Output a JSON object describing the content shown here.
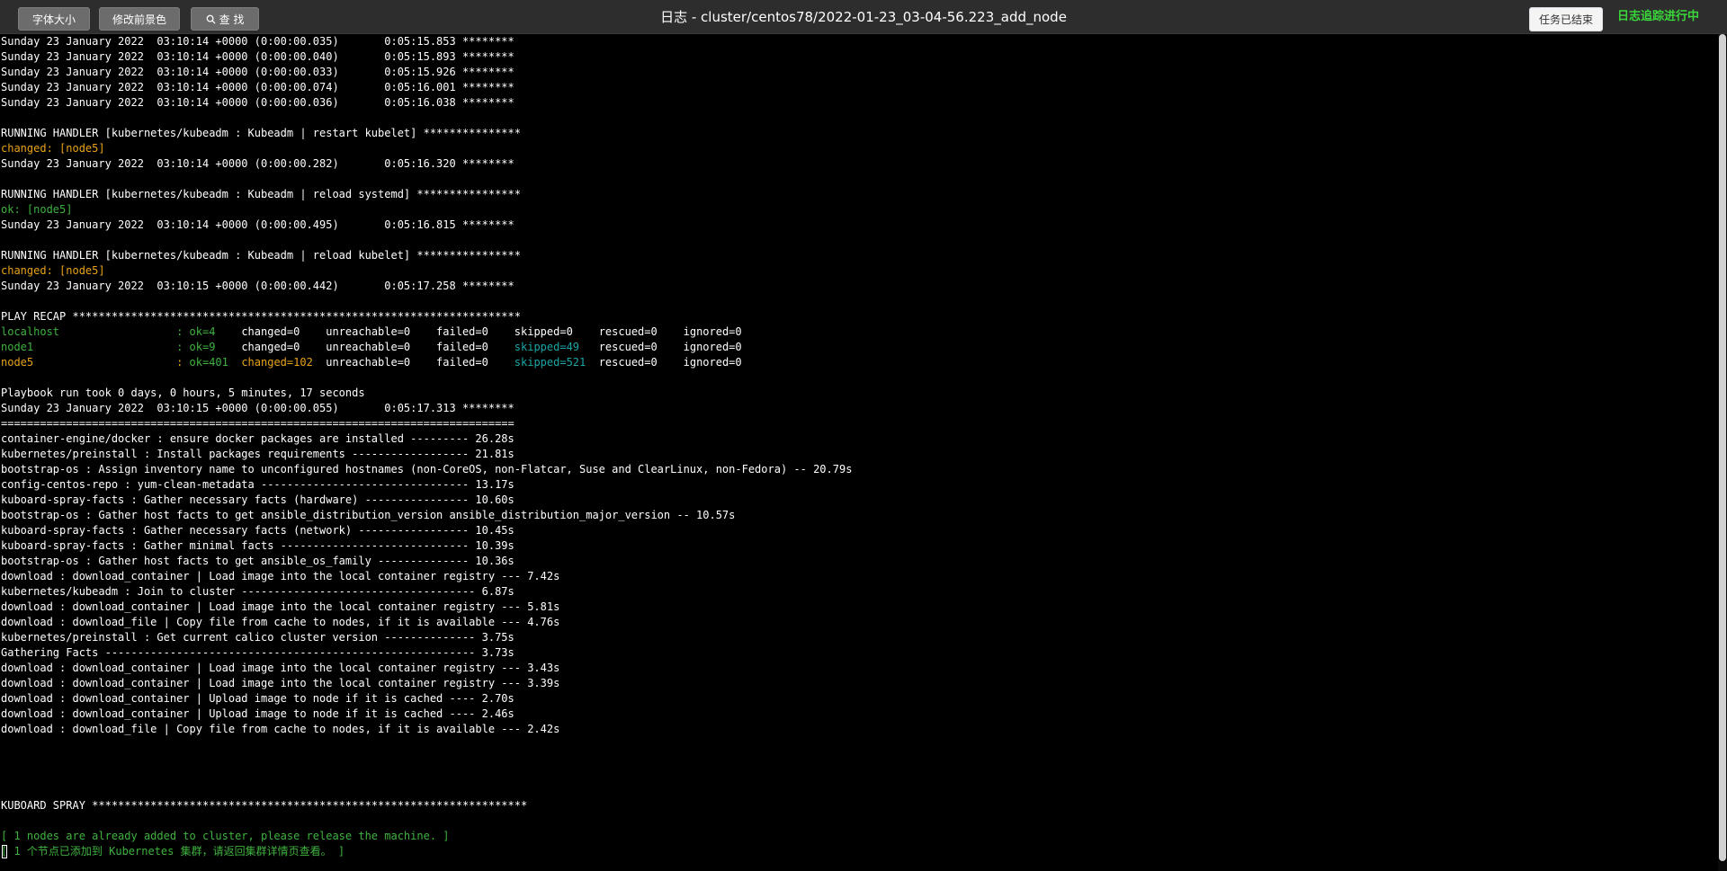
{
  "toolbar": {
    "font_size_label": "字体大小",
    "change_color_label": "修改前景色",
    "search_label": "查 找",
    "search_icon": "search-icon"
  },
  "title": "日志 - cluster/centos78/2022-01-23_03-04-56.223_add_node",
  "task_status_button": "任务已结束",
  "tracking_status": "日志追踪进行中",
  "colors": {
    "background": "#000000",
    "text": "#ffffff",
    "ok_green": "#3fb23f",
    "changed_orange": "#e8a317",
    "skipped_cyan": "#1aa5a5",
    "tracking_green": "#39d739"
  },
  "log": {
    "l0": "Sunday 23 January 2022  03:10:14 +0000 (0:00:00.035)       0:05:15.853 ********",
    "l1": "Sunday 23 January 2022  03:10:14 +0000 (0:00:00.040)       0:05:15.893 ********",
    "l2": "Sunday 23 January 2022  03:10:14 +0000 (0:00:00.033)       0:05:15.926 ********",
    "l3": "Sunday 23 January 2022  03:10:14 +0000 (0:00:00.074)       0:05:16.001 ********",
    "l4": "Sunday 23 January 2022  03:10:14 +0000 (0:00:00.036)       0:05:16.038 ********",
    "l5": "",
    "l6": "RUNNING HANDLER [kubernetes/kubeadm : Kubeadm | restart kubelet] ***************",
    "l7": "changed: [node5]",
    "l8": "Sunday 23 January 2022  03:10:14 +0000 (0:00:00.282)       0:05:16.320 ********",
    "l9": "",
    "l10": "RUNNING HANDLER [kubernetes/kubeadm : Kubeadm | reload systemd] ****************",
    "l11": "ok: [node5]",
    "l12": "Sunday 23 January 2022  03:10:14 +0000 (0:00:00.495)       0:05:16.815 ********",
    "l13": "",
    "l14": "RUNNING HANDLER [kubernetes/kubeadm : Kubeadm | reload kubelet] ****************",
    "l15": "changed: [node5]",
    "l16": "Sunday 23 January 2022  03:10:15 +0000 (0:00:00.442)       0:05:17.258 ********",
    "l17": "",
    "l18": "PLAY RECAP *********************************************************************",
    "r1_host": "localhost                  : ",
    "r1_ok": "ok=4   ",
    "r1_changed": " changed=0   ",
    "r1_mid": " unreachable=0    failed=0    ",
    "r1_skipped": "skipped=0   ",
    "r1_end": " rescued=0    ignored=0",
    "r2_host": "node1                      : ",
    "r2_ok": "ok=9   ",
    "r2_changed": " changed=0   ",
    "r2_mid": " unreachable=0    failed=0    ",
    "r2_skipped": "skipped=49  ",
    "r2_end": " rescued=0    ignored=0",
    "r3_host": "node5                      : ",
    "r3_ok": "ok=401 ",
    "r3_changed": " changed=102 ",
    "r3_mid": " unreachable=0    failed=0    ",
    "r3_skipped": "skipped=521 ",
    "r3_end": " rescued=0    ignored=0",
    "l22": "",
    "l23": "Playbook run took 0 days, 0 hours, 5 minutes, 17 seconds",
    "l24": "Sunday 23 January 2022  03:10:15 +0000 (0:00:00.055)       0:05:17.313 ********",
    "l25": "===============================================================================",
    "l26": "container-engine/docker : ensure docker packages are installed --------- 26.28s",
    "l27": "kubernetes/preinstall : Install packages requirements ------------------ 21.81s",
    "l28": "bootstrap-os : Assign inventory name to unconfigured hostnames (non-CoreOS, non-Flatcar, Suse and ClearLinux, non-Fedora) -- 20.79s",
    "l29": "config-centos-repo : yum-clean-metadata -------------------------------- 13.17s",
    "l30": "kuboard-spray-facts : Gather necessary facts (hardware) ---------------- 10.60s",
    "l31": "bootstrap-os : Gather host facts to get ansible_distribution_version ansible_distribution_major_version -- 10.57s",
    "l32": "kuboard-spray-facts : Gather necessary facts (network) ----------------- 10.45s",
    "l33": "kuboard-spray-facts : Gather minimal facts ----------------------------- 10.39s",
    "l34": "bootstrap-os : Gather host facts to get ansible_os_family -------------- 10.36s",
    "l35": "download : download_container | Load image into the local container registry --- 7.42s",
    "l36": "kubernetes/kubeadm : Join to cluster ------------------------------------ 6.87s",
    "l37": "download : download_container | Load image into the local container registry --- 5.81s",
    "l38": "download : download_file | Copy file from cache to nodes, if it is available --- 4.76s",
    "l39": "kubernetes/preinstall : Get current calico cluster version -------------- 3.75s",
    "l40": "Gathering Facts --------------------------------------------------------- 3.73s",
    "l41": "download : download_container | Load image into the local container registry --- 3.43s",
    "l42": "download : download_container | Load image into the local container registry --- 3.39s",
    "l43": "download : download_container | Upload image to node if it is cached ---- 2.70s",
    "l44": "download : download_container | Upload image to node if it is cached ---- 2.46s",
    "l45": "download : download_file | Copy file from cache to nodes, if it is available --- 2.42s",
    "l46": "",
    "l47": "",
    "l48": "",
    "l49": "",
    "l50": "KUBOARD SPRAY *******************************************************************",
    "l51": "",
    "l52": "[ 1 nodes are already added to cluster, please release the machine. ]",
    "l53": "[ 1 个节点已添加到 Kubernetes 集群，请返回集群详情页查看。 ]"
  }
}
